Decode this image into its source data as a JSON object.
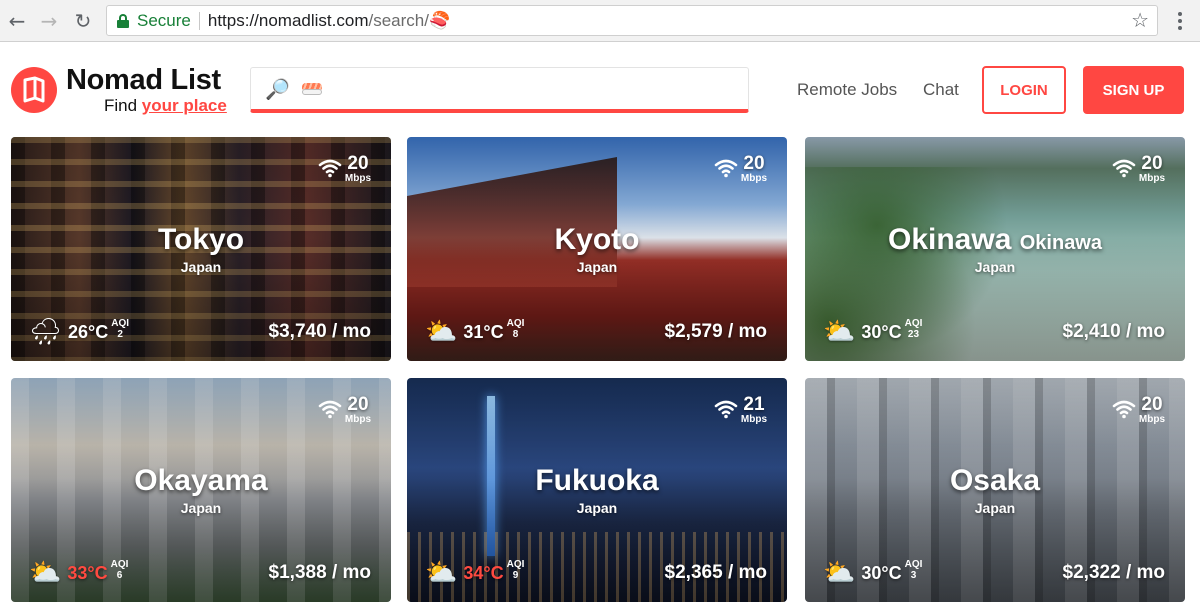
{
  "browser": {
    "secure_label": "Secure",
    "url_host": "https://nomadlist.com",
    "url_path": "/search/🍣"
  },
  "header": {
    "brand_title": "Nomad List",
    "tagline_prefix": "Find ",
    "tagline_highlight": "your place",
    "search_query": "🍣",
    "nav": {
      "remote_jobs": "Remote Jobs",
      "chat": "Chat",
      "login": "LOGIN",
      "signup": "SIGN UP"
    }
  },
  "colors": {
    "brand": "#ff4742",
    "hot_temp": "#ff4a40"
  },
  "cities": [
    {
      "name": "Tokyo",
      "region": "",
      "country": "Japan",
      "internet_speed": "20",
      "speed_unit": "Mbps",
      "weather_icon": "rain-cloud-icon",
      "temp": "26°C",
      "temp_hot": false,
      "aqi_label": "AQI",
      "aqi": "2",
      "price": "$3,740 / mo"
    },
    {
      "name": "Kyoto",
      "region": "",
      "country": "Japan",
      "internet_speed": "20",
      "speed_unit": "Mbps",
      "weather_icon": "sun-behind-cloud-icon",
      "temp": "31°C",
      "temp_hot": false,
      "aqi_label": "AQI",
      "aqi": "8",
      "price": "$2,579 / mo"
    },
    {
      "name": "Okinawa",
      "region": "Okinawa",
      "country": "Japan",
      "internet_speed": "20",
      "speed_unit": "Mbps",
      "weather_icon": "sun-behind-cloud-icon",
      "temp": "30°C",
      "temp_hot": false,
      "aqi_label": "AQI",
      "aqi": "23",
      "price": "$2,410 / mo"
    },
    {
      "name": "Okayama",
      "region": "",
      "country": "Japan",
      "internet_speed": "20",
      "speed_unit": "Mbps",
      "weather_icon": "sun-behind-cloud-icon",
      "temp": "33°C",
      "temp_hot": true,
      "aqi_label": "AQI",
      "aqi": "6",
      "price": "$1,388 / mo"
    },
    {
      "name": "Fukuoka",
      "region": "",
      "country": "Japan",
      "internet_speed": "21",
      "speed_unit": "Mbps",
      "weather_icon": "sun-behind-cloud-icon",
      "temp": "34°C",
      "temp_hot": true,
      "aqi_label": "AQI",
      "aqi": "9",
      "price": "$2,365 / mo"
    },
    {
      "name": "Osaka",
      "region": "",
      "country": "Japan",
      "internet_speed": "20",
      "speed_unit": "Mbps",
      "weather_icon": "sun-behind-cloud-icon",
      "temp": "30°C",
      "temp_hot": false,
      "aqi_label": "AQI",
      "aqi": "3",
      "price": "$2,322 / mo"
    }
  ]
}
